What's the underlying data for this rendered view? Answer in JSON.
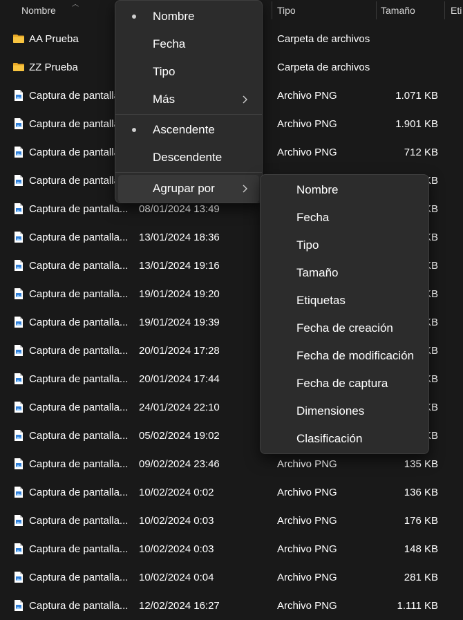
{
  "header": {
    "col_name": "Nombre",
    "col_type": "Tipo",
    "col_size": "Tamaño",
    "col_tags": "Eti"
  },
  "rows": [
    {
      "name": "AA Prueba",
      "date": "",
      "type": "Carpeta de archivos",
      "size": "",
      "icon": "folder-icon"
    },
    {
      "name": "ZZ Prueba",
      "date": "",
      "type": "Carpeta de archivos",
      "size": "",
      "icon": "folder-icon"
    },
    {
      "name": "Captura de pantalla",
      "date": "",
      "type": "Archivo PNG",
      "size": "1.071 KB",
      "icon": "png-file-icon"
    },
    {
      "name": "Captura de pantalla",
      "date": "",
      "type": "Archivo PNG",
      "size": "1.901 KB",
      "icon": "png-file-icon"
    },
    {
      "name": "Captura de pantalla",
      "date": "",
      "type": "Archivo PNG",
      "size": "712 KB",
      "icon": "png-file-icon"
    },
    {
      "name": "Captura de pantalla",
      "date": "",
      "type": "",
      "size": "KB",
      "icon": "png-file-icon"
    },
    {
      "name": "Captura de pantalla...",
      "date": "08/01/2024 13:49",
      "type": "",
      "size": "KB",
      "icon": "png-file-icon"
    },
    {
      "name": "Captura de pantalla...",
      "date": "13/01/2024 18:36",
      "type": "",
      "size": "KB",
      "icon": "png-file-icon"
    },
    {
      "name": "Captura de pantalla...",
      "date": "13/01/2024 19:16",
      "type": "",
      "size": "KB",
      "icon": "png-file-icon"
    },
    {
      "name": "Captura de pantalla...",
      "date": "19/01/2024 19:20",
      "type": "",
      "size": "KB",
      "icon": "png-file-icon"
    },
    {
      "name": "Captura de pantalla...",
      "date": "19/01/2024 19:39",
      "type": "",
      "size": "KB",
      "icon": "png-file-icon"
    },
    {
      "name": "Captura de pantalla...",
      "date": "20/01/2024 17:28",
      "type": "",
      "size": "KB",
      "icon": "png-file-icon"
    },
    {
      "name": "Captura de pantalla...",
      "date": "20/01/2024 17:44",
      "type": "",
      "size": "KB",
      "icon": "png-file-icon"
    },
    {
      "name": "Captura de pantalla...",
      "date": "24/01/2024 22:10",
      "type": "",
      "size": "KB",
      "icon": "png-file-icon"
    },
    {
      "name": "Captura de pantalla...",
      "date": "05/02/2024 19:02",
      "type": "",
      "size": "KB",
      "icon": "png-file-icon"
    },
    {
      "name": "Captura de pantalla...",
      "date": "09/02/2024 23:46",
      "type": "Archivo PNG",
      "size": "135 KB",
      "icon": "png-file-icon"
    },
    {
      "name": "Captura de pantalla...",
      "date": "10/02/2024 0:02",
      "type": "Archivo PNG",
      "size": "136 KB",
      "icon": "png-file-icon"
    },
    {
      "name": "Captura de pantalla...",
      "date": "10/02/2024 0:03",
      "type": "Archivo PNG",
      "size": "176 KB",
      "icon": "png-file-icon"
    },
    {
      "name": "Captura de pantalla...",
      "date": "10/02/2024 0:03",
      "type": "Archivo PNG",
      "size": "148 KB",
      "icon": "png-file-icon"
    },
    {
      "name": "Captura de pantalla...",
      "date": "10/02/2024 0:04",
      "type": "Archivo PNG",
      "size": "281 KB",
      "icon": "png-file-icon"
    },
    {
      "name": "Captura de pantalla...",
      "date": "12/02/2024 16:27",
      "type": "Archivo PNG",
      "size": "1.111 KB",
      "icon": "png-file-icon"
    }
  ],
  "sort_menu": {
    "items": [
      {
        "label": "Nombre",
        "selected": true
      },
      {
        "label": "Fecha",
        "selected": false
      },
      {
        "label": "Tipo",
        "selected": false
      },
      {
        "label": "Más",
        "submenu": true
      }
    ],
    "order_items": [
      {
        "label": "Ascendente",
        "selected": true
      },
      {
        "label": "Descendente",
        "selected": false
      }
    ],
    "group_by": {
      "label": "Agrupar por",
      "submenu": true,
      "highlighted": true
    }
  },
  "group_menu": {
    "items": [
      {
        "label": "Nombre"
      },
      {
        "label": "Fecha"
      },
      {
        "label": "Tipo"
      },
      {
        "label": "Tamaño"
      },
      {
        "label": "Etiquetas"
      },
      {
        "label": "Fecha de creación"
      },
      {
        "label": "Fecha de modificación"
      },
      {
        "label": "Fecha de captura"
      },
      {
        "label": "Dimensiones"
      },
      {
        "label": "Clasificación"
      }
    ]
  },
  "colors": {
    "background": "#191919",
    "menu_background": "#2c2c2c",
    "menu_hover": "#383838",
    "folder_yellow": "#f8c440",
    "png_blue": "#2f7fd8"
  }
}
